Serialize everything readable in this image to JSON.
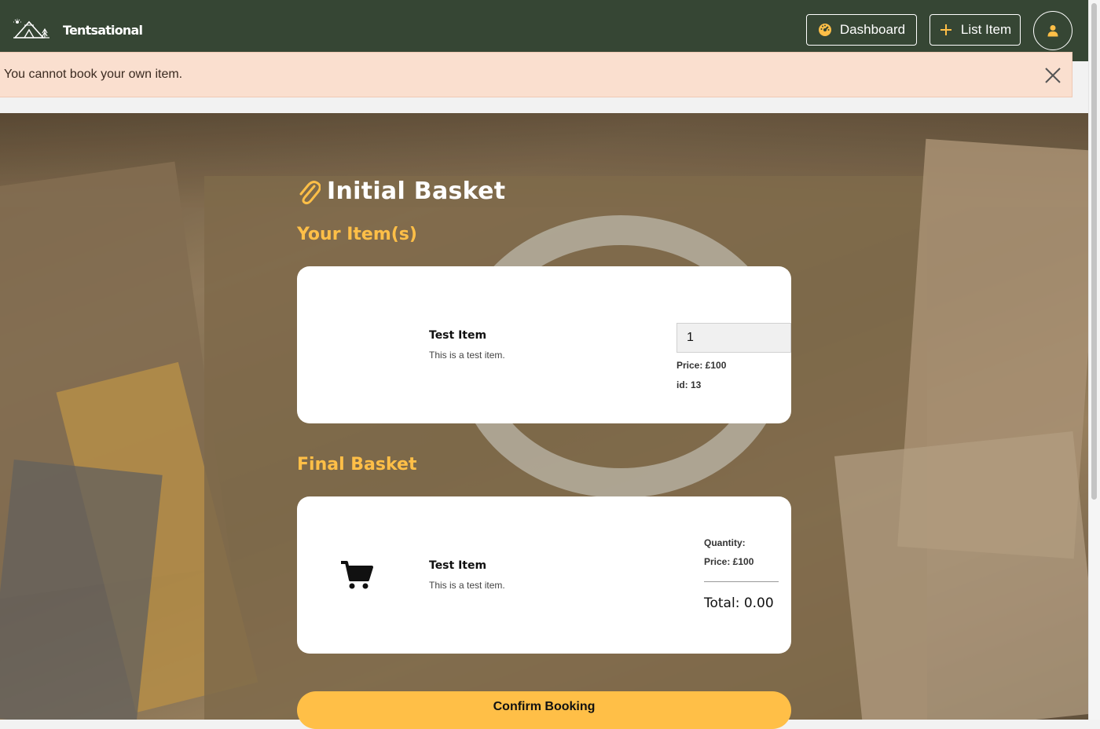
{
  "navbar": {
    "brand": "Tentsational",
    "dashboard_label": "Dashboard",
    "list_item_label": "List Item",
    "dashboard_icon": "dashboard-gauge-icon",
    "list_item_icon": "plus-icon",
    "user_icon": "user-icon",
    "background_color": "#364634"
  },
  "alert": {
    "message": "You cannot book your own item.",
    "close_icon": "close-icon"
  },
  "page": {
    "title": "Initial Basket",
    "title_icon": "paperclip-icon",
    "your_items_heading": "Your Item(s)",
    "final_basket_heading": "Final Basket",
    "accent_color": "#ffbf47"
  },
  "your_items": [
    {
      "name": "Test Item",
      "description": "This is a test item.",
      "quantity": "1",
      "price": "Price: £100",
      "id": "id: 13"
    }
  ],
  "final_basket": [
    {
      "name": "Test Item",
      "description": "This is a test item.",
      "quantity_label": "Quantity:",
      "price": "Price: £100",
      "icon": "shopping-cart-icon"
    }
  ],
  "total": "Total: 0.00",
  "confirm_label": "Confirm Booking"
}
